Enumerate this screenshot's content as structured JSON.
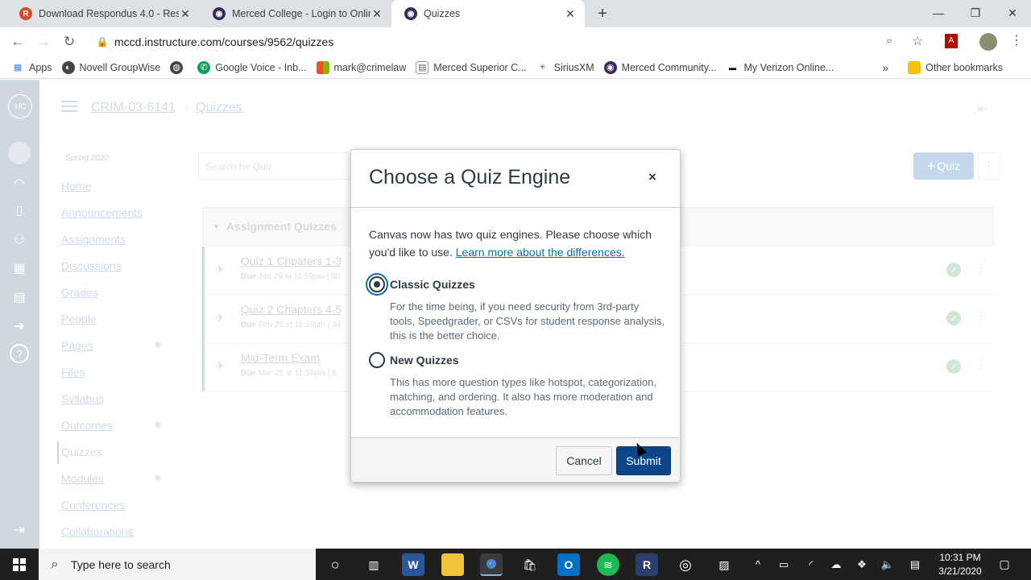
{
  "browser": {
    "tabs": [
      {
        "title": "Download Respondus 4.0 - Respo",
        "favicon": "R"
      },
      {
        "title": "Merced College - Login to Onlin",
        "favicon": "canvas"
      },
      {
        "title": "Quizzes",
        "favicon": "canvas"
      }
    ],
    "new_tab": "+",
    "url": "mccd.instructure.com/courses/9562/quizzes",
    "bookmarks": [
      "Apps",
      "Novell GroupWise",
      "",
      "Google Voice - Inb...",
      "mark@crimelaw",
      "Merced Superior C...",
      "SiriusXM",
      "Merced Community...",
      "My Verizon Online..."
    ],
    "bookmarks_overflow": "»",
    "other_bookmarks": "Other bookmarks"
  },
  "canvas": {
    "breadcrumb": {
      "course": "CRIM-03-6141",
      "page": "Quizzes"
    },
    "term": "Spring 2020",
    "course_nav": [
      "Home",
      "Announcements",
      "Assignments",
      "Discussions",
      "Grades",
      "People",
      "Pages",
      "Files",
      "Syllabus",
      "Outcomes",
      "Quizzes",
      "Modules",
      "Conferences",
      "Collaborations"
    ],
    "search_placeholder": "Search for Quiz",
    "add_quiz": "Quiz",
    "section_title": "Assignment Quizzes",
    "quizzes": [
      {
        "title": "Quiz 1 Chpaters 1-3",
        "due_label": "Due",
        "due": "Jan 29 at 11:59pm",
        "meta": "| 60"
      },
      {
        "title": "Quiz 2 Chapters 4-5",
        "due_label": "Due",
        "due": "Feb 25 at 11:59pm",
        "meta": "| 44"
      },
      {
        "title": "Mid-Term Exam",
        "due_label": "Due",
        "due": "Mar 25 at 11:59pm",
        "meta": "| 6"
      }
    ]
  },
  "dialog": {
    "title": "Choose a Quiz Engine",
    "close": "×",
    "intro": "Canvas now has two quiz engines. Please choose which you'd like to use.",
    "link": "Learn more about the differences.",
    "options": [
      {
        "label": "Classic Quizzes",
        "selected": true,
        "description": "For the time being, if you need security from 3rd-party tools, Speedgrader, or CSVs for student response analysis, this is the better choice."
      },
      {
        "label": "New Quizzes",
        "selected": false,
        "description": "This has more question types like hotspot, categorization, matching, and ordering. It also has more moderation and accommodation features."
      }
    ],
    "cancel": "Cancel",
    "submit": "Submit"
  },
  "taskbar": {
    "search_placeholder": "Type here to search",
    "time": "10:31 PM",
    "date": "3/21/2020"
  },
  "colors": {
    "canvas_blue": "#0b468b",
    "link": "#0770a3",
    "text": "#2d3b45",
    "taskbar": "#1f1f1f"
  }
}
